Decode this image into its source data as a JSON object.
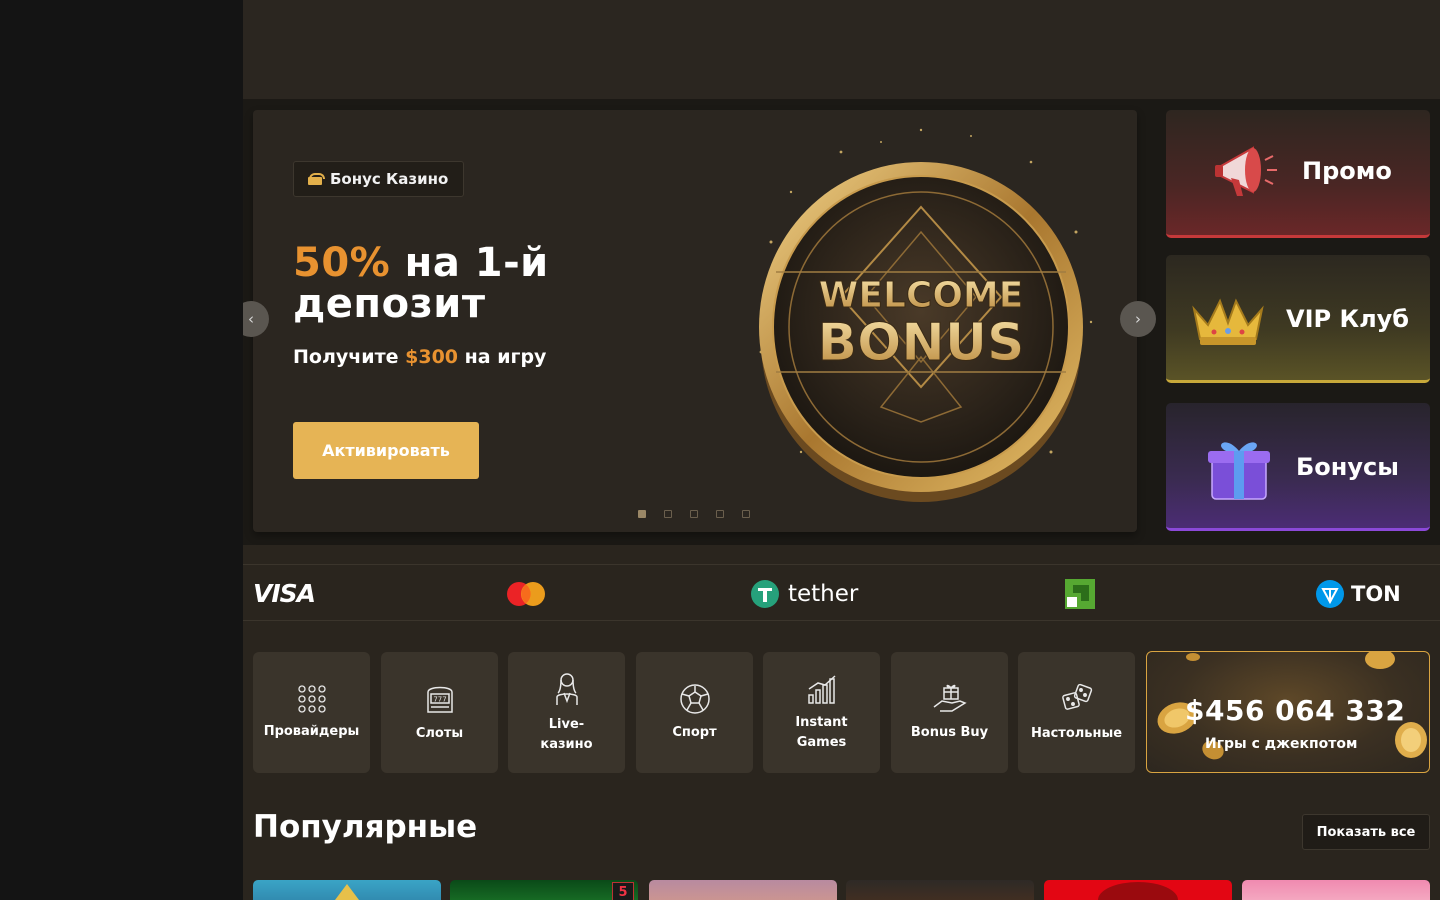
{
  "banner": {
    "tag": "Бонус Казино",
    "headline_accent": "50%",
    "headline_line1_rest": " на 1-й",
    "headline_line2": "депозит",
    "sub_prefix": "Получите ",
    "sub_accent": "$300",
    "sub_suffix": " на игру",
    "cta": "Активировать",
    "art_word1": "WELCOME",
    "art_word2": "BONUS",
    "slide_count": 5,
    "active_slide": 1
  },
  "side_cards": [
    {
      "label": "Промо",
      "icon": "megaphone-icon",
      "accent": "#c5393a"
    },
    {
      "label": "VIP Клуб",
      "icon": "crown-icon",
      "accent": "#c8a93a"
    },
    {
      "label": "Бонусы",
      "icon": "gift-icon",
      "accent": "#8b49d8"
    }
  ],
  "payments": [
    "VISA",
    "mastercard",
    "tether",
    "perfect-money",
    "TON"
  ],
  "payment_labels": {
    "visa": "VISA",
    "tether": "tether",
    "ton": "TON"
  },
  "categories": [
    {
      "label": "Провайдеры",
      "icon": "grid-dots-icon"
    },
    {
      "label": "Слоты",
      "icon": "slot-machine-icon"
    },
    {
      "label": "Live-\nказино",
      "icon": "dealer-icon"
    },
    {
      "label": "Спорт",
      "icon": "soccer-ball-icon"
    },
    {
      "label": "Instant\nGames",
      "icon": "chart-bars-icon"
    },
    {
      "label": "Bonus Buy",
      "icon": "hand-gift-icon"
    },
    {
      "label": "Настольные",
      "icon": "dice-icon"
    }
  ],
  "jackpot": {
    "amount": "$456 064 332",
    "label": "Игры с джекпотом"
  },
  "popular": {
    "title": "Популярные",
    "show_all": "Показать все"
  },
  "arrows": {
    "left": "‹",
    "right": "›"
  },
  "thumb_badge": "5",
  "colors": {
    "accent_orange": "#e89230",
    "gold_button": "#e6b455",
    "background": "#2a251e"
  }
}
